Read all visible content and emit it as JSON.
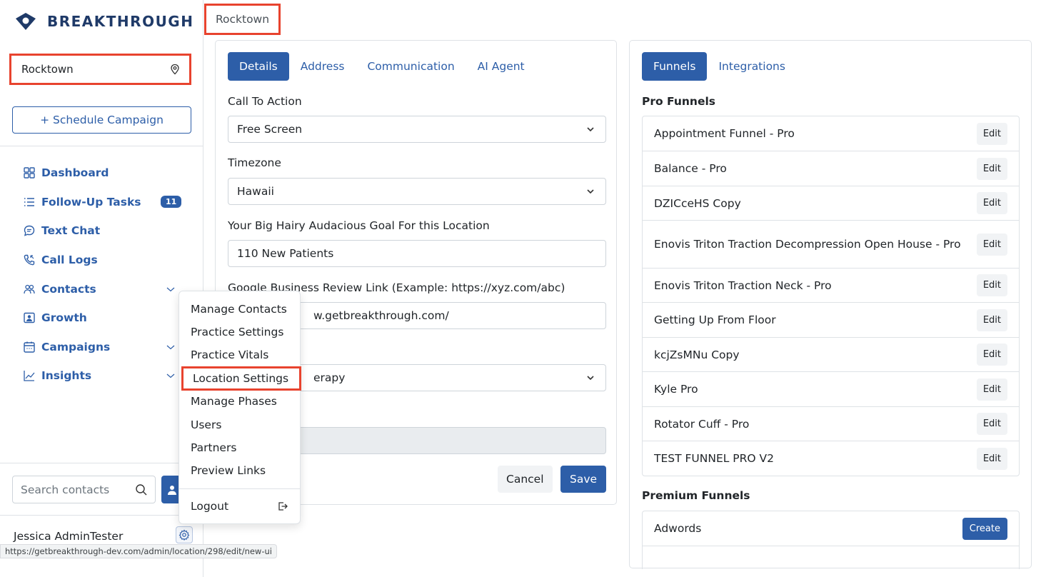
{
  "app": {
    "brand": "BREAKTHROUGH"
  },
  "breadcrumb": {
    "current": "Rocktown"
  },
  "sidebar": {
    "location": "Rocktown",
    "schedule_button": "+ Schedule Campaign",
    "nav": [
      {
        "label": "Dashboard",
        "icon": "dashboard-icon"
      },
      {
        "label": "Follow-Up Tasks",
        "icon": "list-icon",
        "badge": "11"
      },
      {
        "label": "Text Chat",
        "icon": "chat-icon"
      },
      {
        "label": "Call Logs",
        "icon": "phone-icon"
      },
      {
        "label": "Contacts",
        "icon": "contacts-icon",
        "expandable": true
      },
      {
        "label": "Growth",
        "icon": "growth-icon"
      },
      {
        "label": "Campaigns",
        "icon": "calendar-icon",
        "expandable": true
      },
      {
        "label": "Insights",
        "icon": "chart-line-icon",
        "expandable": true
      }
    ],
    "search_placeholder": "Search contacts",
    "user_name": "Jessica AdminTester",
    "status_url": "https://getbreakthrough-dev.com/admin/location/298/edit/new-ui"
  },
  "menu": {
    "items": [
      "Manage Contacts",
      "Practice Settings",
      "Practice Vitals",
      "Location Settings",
      "Manage Phases",
      "Users",
      "Partners",
      "Preview Links"
    ],
    "highlighted": "Location Settings",
    "logout": "Logout"
  },
  "details": {
    "tabs": [
      "Details",
      "Address",
      "Communication",
      "AI Agent"
    ],
    "active_tab": "Details",
    "fields": {
      "cta_label": "Call To Action",
      "cta_value": "Free Screen",
      "timezone_label": "Timezone",
      "timezone_value": "Hawaii",
      "goal_label": "Your Big Hairy Audacious Goal For this Location",
      "goal_value": "110 New Patients",
      "review_label": "Google Business Review Link (Example: https://xyz.com/abc)",
      "review_value_visible": "w.getbreakthrough.com/",
      "type_value_visible": "erapy"
    },
    "cancel": "Cancel",
    "save": "Save"
  },
  "funnels": {
    "tabs": [
      "Funnels",
      "Integrations"
    ],
    "active_tab": "Funnels",
    "pro_title": "Pro Funnels",
    "pro": [
      "Appointment Funnel - Pro",
      "Balance - Pro",
      "DZICceHS Copy",
      "Enovis Triton Traction Decompression Open House - Pro",
      "Enovis Triton Traction Neck - Pro",
      "Getting Up From Floor",
      "kcjZsMNu Copy",
      "Kyle Pro",
      "Rotator Cuff - Pro",
      "TEST FUNNEL PRO V2"
    ],
    "edit_label": "Edit",
    "premium_title": "Premium Funnels",
    "premium": [
      "Adwords"
    ],
    "create_label": "Create"
  },
  "colors": {
    "primary": "#2d5ea8",
    "highlight": "#e8432e",
    "brand_text": "#1f3a68"
  }
}
